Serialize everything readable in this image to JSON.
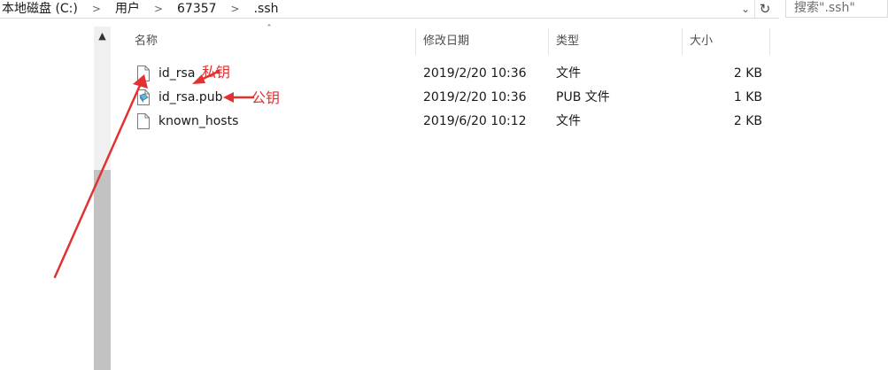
{
  "address": {
    "crumbs": [
      "本地磁盘 (C:)",
      "用户",
      "67357",
      ".ssh"
    ],
    "separator": ">"
  },
  "search": {
    "placeholder": "搜索\".ssh\""
  },
  "columns": {
    "name": "名称",
    "modified": "修改日期",
    "type": "类型",
    "size": "大小"
  },
  "files": [
    {
      "name": "id_rsa",
      "modified": "2019/2/20 10:36",
      "type": "文件",
      "size": "2 KB",
      "icon": "blank-file-icon"
    },
    {
      "name": "id_rsa.pub",
      "modified": "2019/2/20 10:36",
      "type": "PUB 文件",
      "size": "1 KB",
      "icon": "pub-file-icon"
    },
    {
      "name": "known_hosts",
      "modified": "2019/6/20 10:12",
      "type": "文件",
      "size": "2 KB",
      "icon": "blank-file-icon"
    }
  ],
  "annotations": {
    "private_key": "私钥",
    "public_key": "公钥"
  },
  "colors": {
    "annotation": "#e23131",
    "scroll_thumb": "#c2c2c2"
  }
}
